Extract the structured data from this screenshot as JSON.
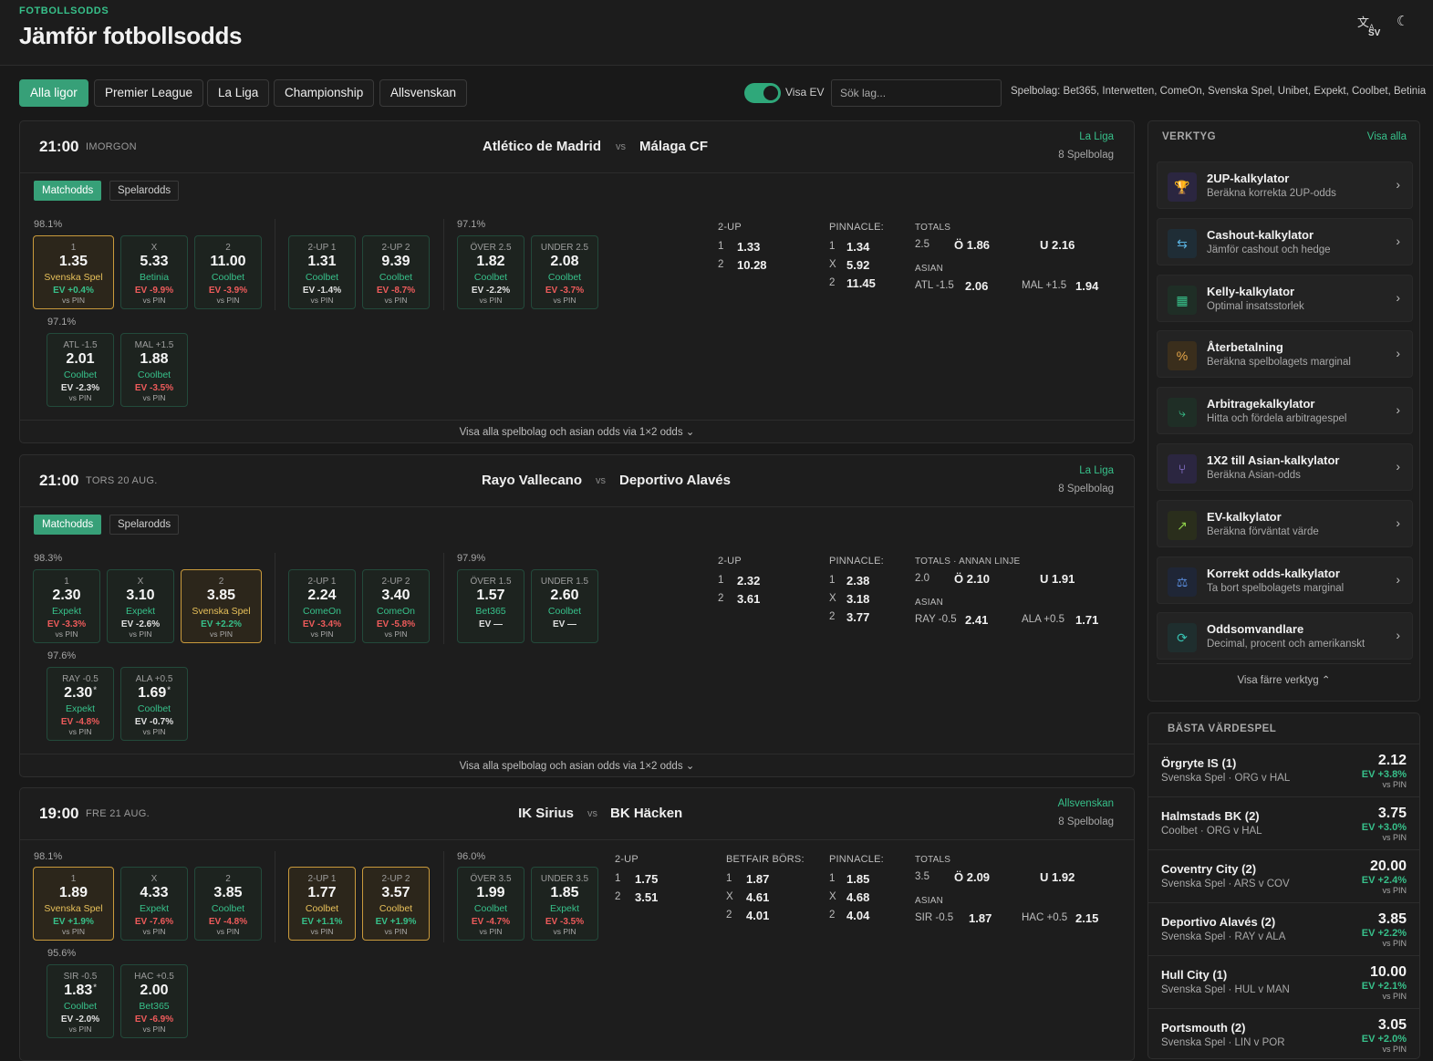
{
  "header": {
    "eyebrow": "FOTBOLLSODDS",
    "title": "Jämför fotbollsodds",
    "lang": "SV",
    "translate_icon": "translate-icon",
    "theme_icon": "moon-icon"
  },
  "filters": {
    "leagues": [
      "Alla ligor",
      "Premier League",
      "La Liga",
      "Championship",
      "Allsvenskan"
    ],
    "active": "Alla ligor",
    "ev_toggle_label": "Visa EV",
    "ev_toggle_on": true,
    "search_placeholder": "Sök lag...",
    "bookmakers_text": "Spelbolag: Bet365, Interwetten, ComeOn, Svenska Spel, Unibet, Expekt, Coolbet, Betinia"
  },
  "tabs": {
    "match": "Matchodds",
    "player": "Spelarodds"
  },
  "labels": {
    "twoup": "2-UP",
    "pinnacle": "PINNACLE:",
    "betfair": "BETFAIR BÖRS:",
    "totals": "TOTALS",
    "asian": "ASIAN",
    "expand": "Visa alla spelbolag och asian odds via 1×2 odds ⌄",
    "vs": "vs",
    "vs_pin": "vs PIN",
    "one": "1",
    "x": "X",
    "two": "2"
  },
  "matches": [
    {
      "time": "21:00",
      "day": "IMORGON",
      "home": "Atlético de Madrid",
      "away": "Málaga CF",
      "league": "La Liga",
      "books": "8 Spelbolag",
      "pct1x2": "98.1%",
      "pctou": "97.1%",
      "pctah": "97.1%",
      "boxes1x2": [
        {
          "label": "1",
          "odd": "1.35",
          "book": "Svenska Spel",
          "ev": "EV +0.4%"
        },
        {
          "label": "X",
          "odd": "5.33",
          "book": "Betinia",
          "ev": "EV -9.9%"
        },
        {
          "label": "2",
          "odd": "11.00",
          "book": "Coolbet",
          "ev": "EV -3.9%"
        }
      ],
      "boxes2up": [
        {
          "label": "2-UP 1",
          "odd": "1.31",
          "book": "Coolbet",
          "ev": "EV -1.4%"
        },
        {
          "label": "2-UP 2",
          "odd": "9.39",
          "book": "Coolbet",
          "ev": "EV -8.7%"
        }
      ],
      "boxesou": [
        {
          "label": "ÖVER 2.5",
          "odd": "1.82",
          "book": "Coolbet",
          "ev": "EV -2.2%"
        },
        {
          "label": "UNDER 2.5",
          "odd": "2.08",
          "book": "Coolbet",
          "ev": "EV -3.7%"
        }
      ],
      "boxesah": [
        {
          "label": "ATL -1.5",
          "odd": "2.01",
          "book": "Coolbet",
          "ev": "EV -2.3%"
        },
        {
          "label": "MAL +1.5",
          "odd": "1.88",
          "book": "Coolbet",
          "ev": "EV -3.5%"
        }
      ],
      "twoup": {
        "1": "1.33",
        "2": "10.28"
      },
      "pinnacle": {
        "1": "1.34",
        "x": "5.92",
        "2": "11.45"
      },
      "totals": {
        "title": "TOTALS",
        "line": "2.5",
        "over": "Ö 1.86",
        "under": "U 2.16"
      },
      "asian": {
        "home_label": "ATL -1.5",
        "home_odd": "2.06",
        "away_label": "MAL +1.5",
        "away_odd": "1.94"
      }
    },
    {
      "time": "21:00",
      "day": "TORS 20 AUG.",
      "home": "Rayo Vallecano",
      "away": "Deportivo Alavés",
      "league": "La Liga",
      "books": "8 Spelbolag",
      "pct1x2": "98.3%",
      "pctou": "97.9%",
      "pctah": "97.6%",
      "boxes1x2": [
        {
          "label": "1",
          "odd": "2.30",
          "book": "Expekt",
          "ev": "EV -3.3%"
        },
        {
          "label": "X",
          "odd": "3.10",
          "book": "Expekt",
          "ev": "EV -2.6%"
        },
        {
          "label": "2",
          "odd": "3.85",
          "book": "Svenska Spel",
          "ev": "EV +2.2%"
        }
      ],
      "boxes2up": [
        {
          "label": "2-UP 1",
          "odd": "2.24",
          "book": "ComeOn",
          "ev": "EV -3.4%"
        },
        {
          "label": "2-UP 2",
          "odd": "3.40",
          "book": "ComeOn",
          "ev": "EV -5.8%"
        }
      ],
      "boxesou": [
        {
          "label": "ÖVER 1.5",
          "odd": "1.57",
          "book": "Bet365",
          "ev": "EV —"
        },
        {
          "label": "UNDER 1.5",
          "odd": "2.60",
          "book": "Coolbet",
          "ev": "EV —"
        }
      ],
      "boxesah": [
        {
          "label": "RAY -0.5",
          "odd": "2.30",
          "book": "Expekt",
          "ev": "EV -4.8%"
        },
        {
          "label": "ALA +0.5",
          "odd": "1.69",
          "book": "Coolbet",
          "ev": "EV -0.7%"
        }
      ],
      "twoup": {
        "1": "2.32",
        "2": "3.61"
      },
      "pinnacle": {
        "1": "2.38",
        "x": "3.18",
        "2": "3.77"
      },
      "totals": {
        "title": "TOTALS · ANNAN LINJE",
        "line": "2.0",
        "over": "Ö 2.10",
        "under": "U 1.91"
      },
      "asian": {
        "home_label": "RAY -0.5",
        "home_odd": "2.41",
        "away_label": "ALA +0.5",
        "away_odd": "1.71"
      }
    },
    {
      "time": "19:00",
      "day": "FRE 21 AUG.",
      "home": "IK Sirius",
      "away": "BK Häcken",
      "league": "Allsvenskan",
      "books": "8 Spelbolag",
      "pct1x2": "98.1%",
      "pctou": "96.0%",
      "pctah": "95.6%",
      "boxes1x2": [
        {
          "label": "1",
          "odd": "1.89",
          "book": "Svenska Spel",
          "ev": "EV +1.9%"
        },
        {
          "label": "X",
          "odd": "4.33",
          "book": "Expekt",
          "ev": "EV -7.6%"
        },
        {
          "label": "2",
          "odd": "3.85",
          "book": "Coolbet",
          "ev": "EV -4.8%"
        }
      ],
      "boxes2up": [
        {
          "label": "2-UP 1",
          "odd": "1.77",
          "book": "Coolbet",
          "ev": "EV +1.1%"
        },
        {
          "label": "2-UP 2",
          "odd": "3.57",
          "book": "Coolbet",
          "ev": "EV +1.9%"
        }
      ],
      "boxesou": [
        {
          "label": "ÖVER 3.5",
          "odd": "1.99",
          "book": "Coolbet",
          "ev": "EV -4.7%"
        },
        {
          "label": "UNDER 3.5",
          "odd": "1.85",
          "book": "Expekt",
          "ev": "EV -3.5%"
        }
      ],
      "boxesah": [
        {
          "label": "SIR -0.5",
          "odd": "1.83",
          "book": "Coolbet",
          "ev": "EV -2.0%"
        },
        {
          "label": "HAC +0.5",
          "odd": "2.00",
          "book": "Bet365",
          "ev": "EV -6.9%"
        }
      ],
      "twoup": {
        "1": "1.75",
        "2": "3.51"
      },
      "betfair": {
        "1": "1.87",
        "x": "4.61",
        "2": "4.01"
      },
      "pinnacle": {
        "1": "1.85",
        "x": "4.68",
        "2": "4.04"
      },
      "totals": {
        "title": "TOTALS",
        "line": "3.5",
        "over": "Ö 2.09",
        "under": "U 1.92"
      },
      "asian": {
        "home_label": "SIR -0.5",
        "home_odd": "1.87",
        "away_label": "HAC +0.5",
        "away_odd": "2.15"
      }
    }
  ],
  "tools": {
    "title": "VERKTYG",
    "show_all": "Visa alla",
    "show_less": "Visa färre verktyg ⌃",
    "items": [
      {
        "name": "2UP-kalkylator",
        "desc": "Beräkna korrekta 2UP-odds",
        "icon": "trophy-icon",
        "glyph": "🏆",
        "color": "#2b2640",
        "fg": "#a78bfa"
      },
      {
        "name": "Cashout-kalkylator",
        "desc": "Jämför cashout och hedge",
        "icon": "swap-arrows-icon",
        "glyph": "⇆",
        "color": "#1f2d36",
        "fg": "#5ab2e0"
      },
      {
        "name": "Kelly-kalkylator",
        "desc": "Optimal insatsstorlek",
        "icon": "calculator-icon",
        "glyph": "▦",
        "color": "#1f2e26",
        "fg": "#37c08a"
      },
      {
        "name": "Återbetalning",
        "desc": "Beräkna spelbolagets marginal",
        "icon": "percent-icon",
        "glyph": "%",
        "color": "#3a2e1c",
        "fg": "#e8a84a"
      },
      {
        "name": "Arbitragekalkylator",
        "desc": "Hitta och fördela arbitragespel",
        "icon": "route-icon",
        "glyph": "⤷",
        "color": "#1f2e26",
        "fg": "#37c08a"
      },
      {
        "name": "1X2 till Asian-kalkylator",
        "desc": "Beräkna Asian-odds",
        "icon": "split-icon",
        "glyph": "⑂",
        "color": "#2b2640",
        "fg": "#a78bfa"
      },
      {
        "name": "EV-kalkylator",
        "desc": "Beräkna förväntat värde",
        "icon": "trend-up-icon",
        "glyph": "↗",
        "color": "#2a2e1c",
        "fg": "#8fcf4a"
      },
      {
        "name": "Korrekt odds-kalkylator",
        "desc": "Ta bort spelbolagets marginal",
        "icon": "scale-icon",
        "glyph": "⚖",
        "color": "#1f2636",
        "fg": "#5a8ee0"
      },
      {
        "name": "Oddsomvandlare",
        "desc": "Decimal, procent och amerikanskt",
        "icon": "refresh-icon",
        "glyph": "⟳",
        "color": "#1f2e2e",
        "fg": "#37c0b0"
      }
    ]
  },
  "value_bets": {
    "title": "BÄSTA VÄRDESPEL",
    "items": [
      {
        "team": "Örgryte IS (1)",
        "sub": "Svenska Spel · ORG v HAL",
        "odd": "2.12",
        "ev": "EV +3.8%"
      },
      {
        "team": "Halmstads BK (2)",
        "sub": "Coolbet · ORG v HAL",
        "odd": "3.75",
        "ev": "EV +3.0%"
      },
      {
        "team": "Coventry City (2)",
        "sub": "Svenska Spel · ARS v COV",
        "odd": "20.00",
        "ev": "EV +2.4%"
      },
      {
        "team": "Deportivo Alavés (2)",
        "sub": "Svenska Spel · RAY v ALA",
        "odd": "3.85",
        "ev": "EV +2.2%"
      },
      {
        "team": "Hull City (1)",
        "sub": "Svenska Spel · HUL v MAN",
        "odd": "10.00",
        "ev": "EV +2.1%"
      },
      {
        "team": "Portsmouth (2)",
        "sub": "Svenska Spel · LIN v POR",
        "odd": "3.05",
        "ev": "EV +2.0%"
      }
    ]
  }
}
